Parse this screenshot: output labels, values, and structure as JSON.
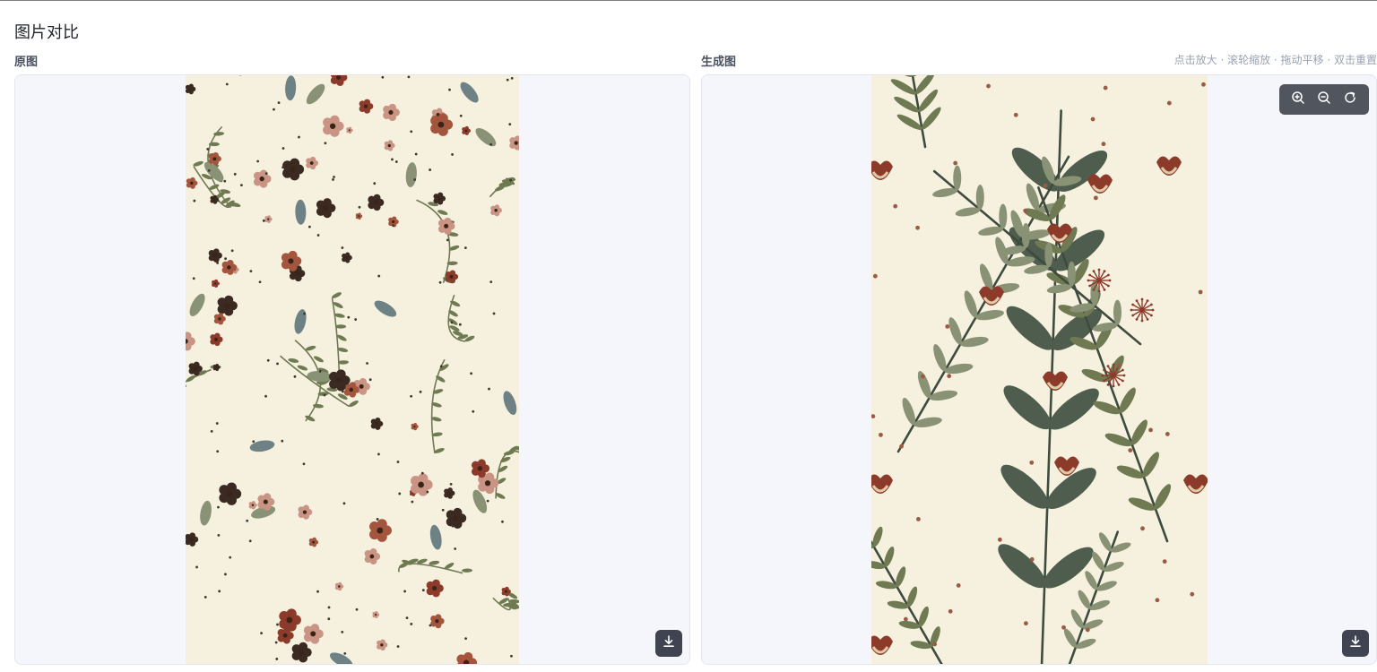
{
  "page": {
    "title": "图片对比"
  },
  "original": {
    "label": "原图",
    "image_alt": "原图",
    "download_icon": "download-icon"
  },
  "generated": {
    "label": "生成图",
    "hint": "点击放大 · 滚轮缩放 · 拖动平移 · 双击重置",
    "image_alt": "生成图",
    "zoom_in_icon": "zoom-in-icon",
    "zoom_out_icon": "zoom-out-icon",
    "reset_icon": "reset-icon",
    "download_icon": "download-icon"
  },
  "colors": {
    "background_cream": "#f6f1df",
    "leaf_olive": "#6f7a52",
    "leaf_dark": "#3e4b3f",
    "leaf_sage": "#8a9275",
    "flower_rust": "#8c3a2a",
    "flower_pink": "#c99484",
    "toolbar_dark": "#3a3f48"
  }
}
